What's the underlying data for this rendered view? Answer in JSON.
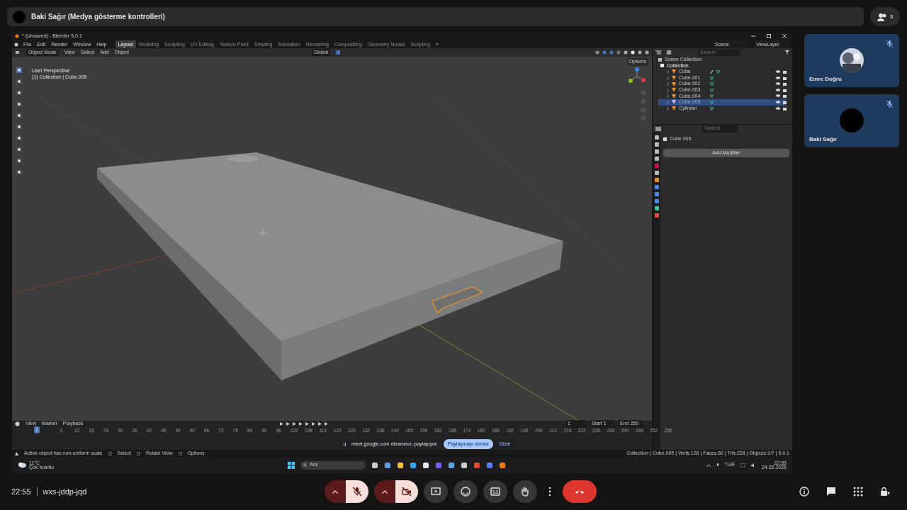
{
  "meet": {
    "presenter": "Baki Sağır (Medya gösterme kontrolleri)",
    "people_count": "3",
    "time": "22:55",
    "meeting_code": "wxs-jddp-jqd",
    "controls": [
      {
        "kind": "mic",
        "on": false
      },
      {
        "kind": "camera",
        "on": false
      },
      {
        "kind": "present"
      },
      {
        "kind": "emoji"
      },
      {
        "kind": "captions"
      },
      {
        "kind": "hand"
      },
      {
        "kind": "more"
      },
      {
        "kind": "leave"
      }
    ],
    "side_controls": [
      {
        "kind": "info"
      },
      {
        "kind": "chat"
      },
      {
        "kind": "activities"
      },
      {
        "kind": "host"
      }
    ]
  },
  "participants": [
    {
      "name": "Emre Doğru",
      "muted": true
    },
    {
      "name": "Baki Sağır",
      "muted": true,
      "kind": "plain"
    }
  ],
  "blender": {
    "title": "* (Unsaved) - Blender 5.0.1",
    "menus": [
      "File",
      "Edit",
      "Render",
      "Window",
      "Help"
    ],
    "workspaces": [
      {
        "label": "Layout",
        "selected": true
      },
      {
        "label": "Modeling",
        "selected": false
      },
      {
        "label": "Sculpting",
        "selected": false
      },
      {
        "label": "UV Editing",
        "selected": false
      },
      {
        "label": "Texture Paint",
        "selected": false
      },
      {
        "label": "Shading",
        "selected": false
      },
      {
        "label": "Animation",
        "selected": false
      },
      {
        "label": "Rendering",
        "selected": false
      },
      {
        "label": "Compositing",
        "selected": false
      },
      {
        "label": "Geometry Nodes",
        "selected": false
      },
      {
        "label": "Scripting",
        "selected": false
      }
    ],
    "add_workspace": "+",
    "scene": "Scene",
    "view_layer": "ViewLayer",
    "mode": "Object Mode",
    "header_menus": [
      "View",
      "Select",
      "Add",
      "Object"
    ],
    "orientation": "Global",
    "viewport": {
      "perspective": "User Perspective",
      "context": "(1) Collection | Cube.005",
      "options": "Options"
    },
    "outliner": {
      "search_placeholder": "Search",
      "root": "Scene Collection",
      "collection": "Collection",
      "objects": [
        {
          "name": "Cube",
          "selected": false,
          "modifier": true
        },
        {
          "name": "Cube.001",
          "selected": false,
          "modifier": false
        },
        {
          "name": "Cube.002",
          "selected": false,
          "modifier": false
        },
        {
          "name": "Cube.003",
          "selected": false,
          "modifier": false
        },
        {
          "name": "Cube.004",
          "selected": false,
          "modifier": false
        },
        {
          "name": "Cube.005",
          "selected": true,
          "modifier": false
        },
        {
          "name": "Cylinder",
          "selected": false,
          "modifier": false
        }
      ]
    },
    "properties": {
      "search_placeholder": "Search",
      "object": "Cube.005",
      "add_modifier": "Add Modifier"
    },
    "timeline": {
      "menus": [
        "View",
        "Marker",
        "Playback"
      ],
      "current_frame": "1",
      "playhead": "1",
      "start_label": "Start",
      "start": "1",
      "end_label": "End",
      "end": "250",
      "ticks": [
        "6",
        "12",
        "18",
        "24",
        "30",
        "36",
        "42",
        "48",
        "54",
        "60",
        "66",
        "72",
        "78",
        "84",
        "90",
        "96",
        "102",
        "108",
        "114",
        "120",
        "126",
        "132",
        "138",
        "144",
        "150",
        "156",
        "162",
        "168",
        "174",
        "180",
        "186",
        "192",
        "198",
        "204",
        "210",
        "216",
        "222",
        "228",
        "234",
        "240",
        "246",
        "252",
        "258"
      ]
    },
    "share_bar": {
      "message": "meet.google.com ekranınızı paylaşıyor.",
      "stop": "Paylaşmayı durdur",
      "hide": "Gizle"
    },
    "status": {
      "hints": [
        "Active object has non-uniform scale",
        "Select",
        "Rotate View",
        "Options"
      ],
      "stats": "Collection | Cube.005 | Verts:128 | Faces:82 | Tris:228 | Objects:1/7 | 5.0.1"
    },
    "taskbar": {
      "temperature": "11°C",
      "weather": "Çok bulutlu",
      "search_placeholder": "Ara",
      "language": "TUR",
      "time": "22:55",
      "date": "24.02.2026"
    }
  }
}
